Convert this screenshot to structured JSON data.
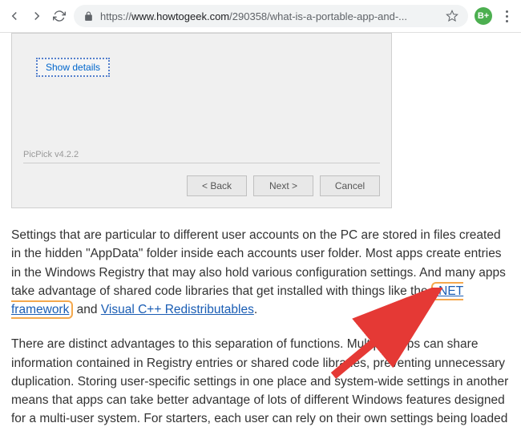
{
  "browser": {
    "url_scheme": "https://",
    "url_domain": "www.howtogeek.com",
    "url_path": "/290358/what-is-a-portable-app-and-...",
    "ext_badge": "B+"
  },
  "installer": {
    "show_details": "Show details",
    "version_label": "PicPick v4.2.2",
    "back_btn": "< Back",
    "next_btn": "Next >",
    "cancel_btn": "Cancel"
  },
  "article": {
    "p1_a": "Settings that are particular to different user accounts on the PC are stored in files created in the hidden \"AppData\" folder inside each accounts user folder. Most apps create entries in the Windows Registry that may also hold various configuration settings. And many apps take advantage of shared code libraries that get installed with things like the ",
    "link_net": ".NET framework",
    "p1_b": " and ",
    "link_vc": "Visual C++ Redistributables",
    "p1_c": ".",
    "p2": "There are distinct advantages to this separation of functions. Multiple apps can share information contained in Registry entries or shared code libraries, preventing unnecessary duplication. Storing user-specific settings in one place and system-wide settings in another means that apps can take better advantage of lots of different Windows features designed for a multi-user system. For starters, each user can rely on their own settings being loaded"
  }
}
